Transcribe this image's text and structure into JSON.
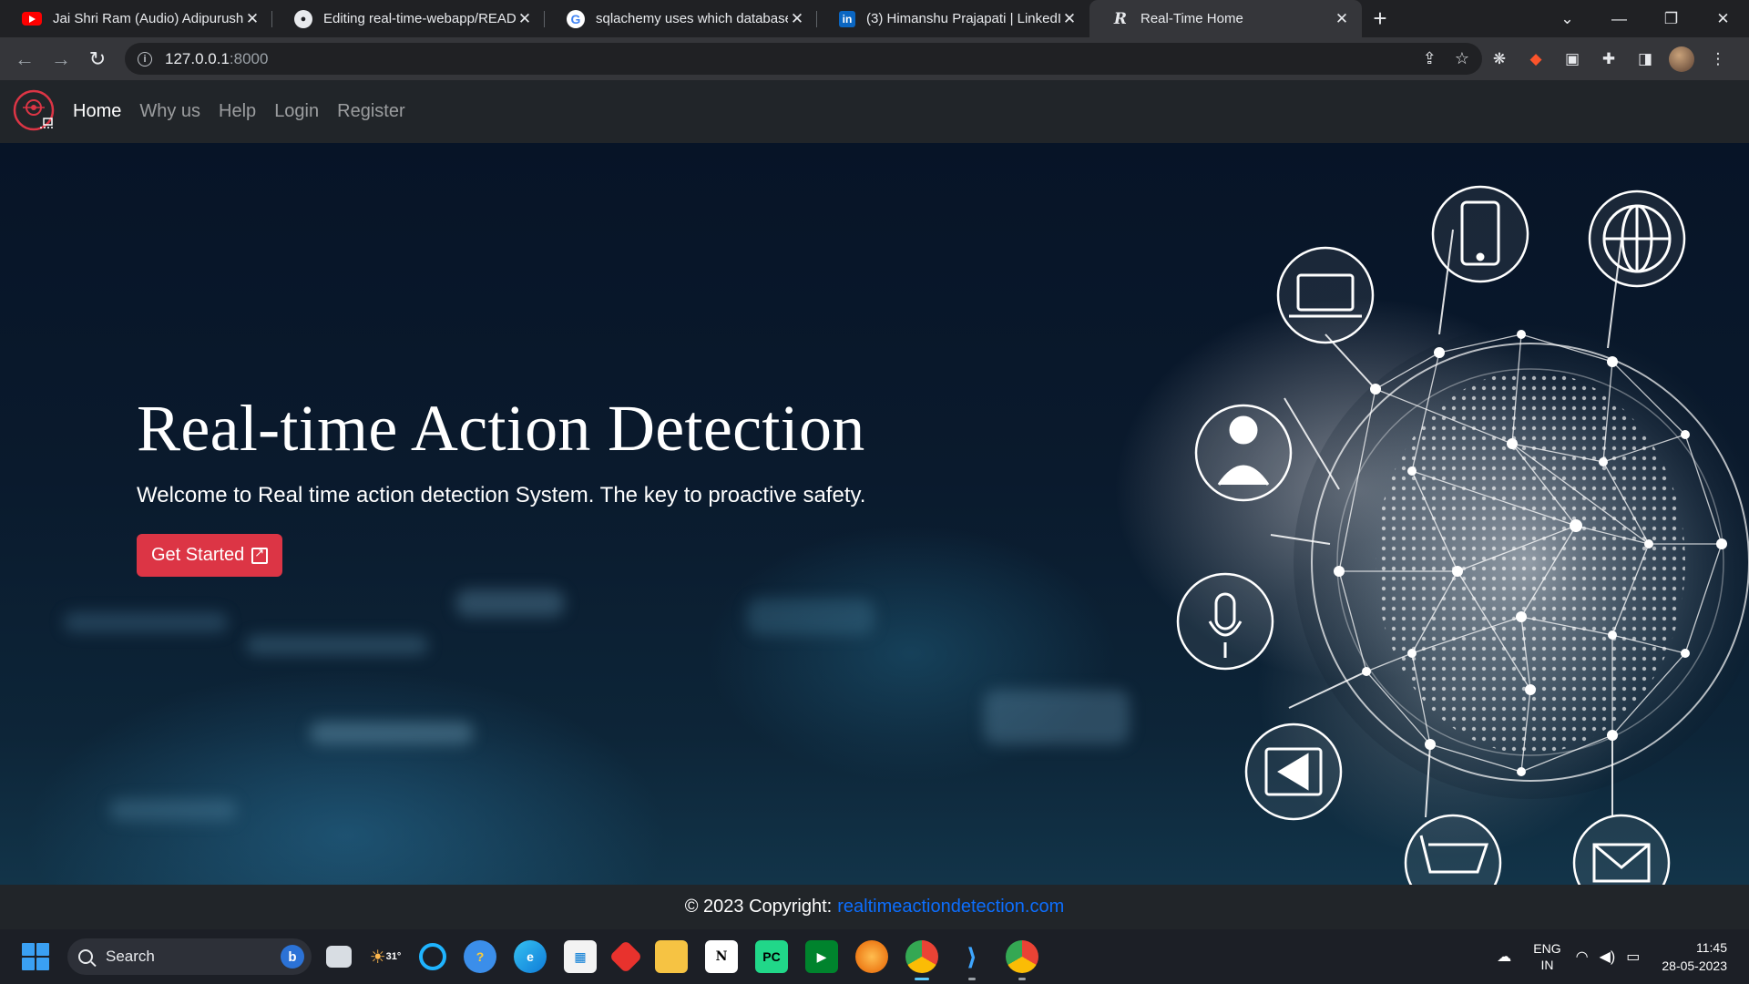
{
  "browser": {
    "tabs": [
      {
        "title": "Jai Shri Ram (Audio) Adipurush | Prabh",
        "favicon": "youtube-icon",
        "active": false
      },
      {
        "title": "Editing real-time-webapp/README.md",
        "favicon": "github-icon",
        "active": false
      },
      {
        "title": "sqlachemy uses which database",
        "favicon": "google-icon",
        "active": false
      },
      {
        "title": "(3) Himanshu Prajapati | LinkedIn",
        "favicon": "linkedin-icon",
        "active": false
      },
      {
        "title": "Real-Time Home",
        "favicon": "site-icon",
        "active": true
      }
    ],
    "url_host": "127.0.0.1",
    "url_port": ":8000"
  },
  "site": {
    "nav": {
      "links": [
        "Home",
        "Why us",
        "Help",
        "Login",
        "Register"
      ],
      "active": "Home"
    },
    "hero": {
      "title": "Real-time Action Detection",
      "subtitle": "Welcome to Real time action detection System. The key to proactive safety.",
      "cta_label": "Get Started"
    },
    "footer": {
      "copyright": "© 2023 Copyright:",
      "link_text": "realtimeactiondetection.com"
    }
  },
  "taskbar": {
    "search_placeholder": "Search",
    "weather_temp": "31°",
    "lang_line1": "ENG",
    "lang_line2": "IN",
    "time": "11:45",
    "date": "28-05-2023"
  },
  "colors": {
    "accent_red": "#dc3545",
    "link_blue": "#0d6efd",
    "navbar_bg": "#212529"
  }
}
